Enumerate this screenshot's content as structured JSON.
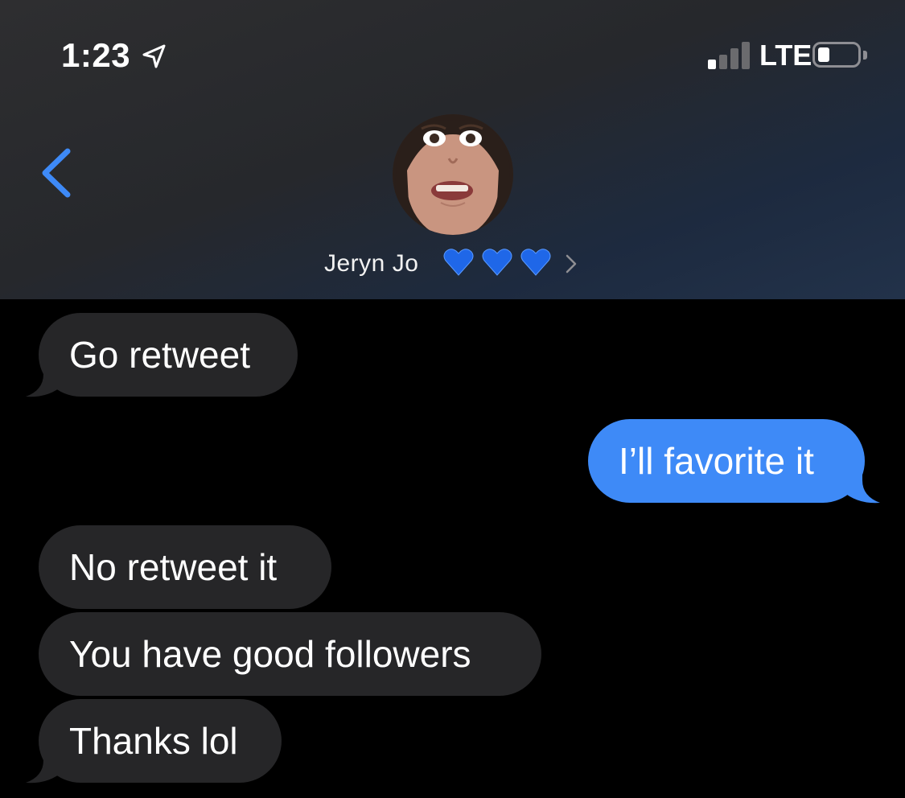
{
  "status_bar": {
    "time": "1:23",
    "network": "LTE",
    "location_icon": "location-arrow-icon",
    "signal_bars_active": 1,
    "signal_bars_total": 4,
    "battery_level": 0.2
  },
  "header": {
    "back_icon": "chevron-left-icon",
    "contact_name": "Jeryn Jo",
    "contact_emoji": "💙💙💙",
    "disclosure_icon": "chevron-right-icon",
    "accent_color": "#3e8af7"
  },
  "messages": [
    {
      "direction": "incoming",
      "text": "Go retweet"
    },
    {
      "direction": "outgoing",
      "text": "I’ll favorite it"
    },
    {
      "direction": "incoming",
      "text": "No retweet it"
    },
    {
      "direction": "incoming",
      "text": "You have good followers"
    },
    {
      "direction": "incoming",
      "text": "Thanks lol"
    }
  ],
  "colors": {
    "incoming_bubble": "#262628",
    "outgoing_bubble": "#3e8af7",
    "background": "#000000"
  }
}
